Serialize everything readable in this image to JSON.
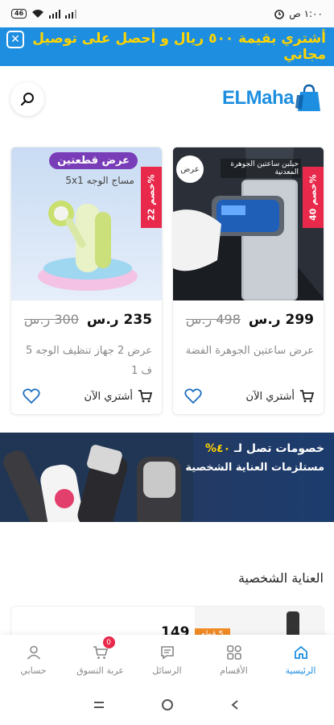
{
  "status_bar": {
    "time": "١:٠٠ ص",
    "battery": "46"
  },
  "promo": {
    "text": "أشتري بقيمة ٥٠٠ ريال و أحصل على توصيل مجاني"
  },
  "header": {
    "logo_text": "ELMaha"
  },
  "products": [
    {
      "discount": "خصم 40%",
      "badge": "عرض",
      "image_caption": "حيلبن ساعتين الجوهرة المعدنية",
      "price": "299 ر.س",
      "old_price": "498 ر.س",
      "name": "عرض ساعتين الجوهرة الفضة",
      "buy_label": "أشتري الآن"
    },
    {
      "discount": "خصم 22%",
      "image_title": "عرض قطعتين",
      "image_subtitle": "مساج الوجه 5x1",
      "price": "235 ر.س",
      "old_price": "300 ر.س",
      "name": "عرض 2 جهاز تنظيف الوجه 5 ف 1",
      "buy_label": "أشتري الآن"
    }
  ],
  "ad_banner": {
    "line1_prefix": "خصومات تصل لـ",
    "line1_pct": "٤٠%",
    "line2": "مستلزمات العناية الشخصية"
  },
  "section": {
    "title": "العناية الشخصية"
  },
  "peek_card": {
    "price": "149",
    "tag": "5 قطع"
  },
  "bottom_nav": {
    "items": [
      {
        "label": "الرئيسية",
        "icon": "home-icon"
      },
      {
        "label": "الأقسام",
        "icon": "grid-icon"
      },
      {
        "label": "الرسائل",
        "icon": "chat-icon"
      },
      {
        "label": "عربة التسوق",
        "icon": "cart-icon",
        "badge": "0"
      },
      {
        "label": "حسابي",
        "icon": "user-icon"
      }
    ]
  },
  "colors": {
    "brand": "#1e8fe0",
    "promo_text": "#ffd400",
    "discount": "#e8294b"
  }
}
